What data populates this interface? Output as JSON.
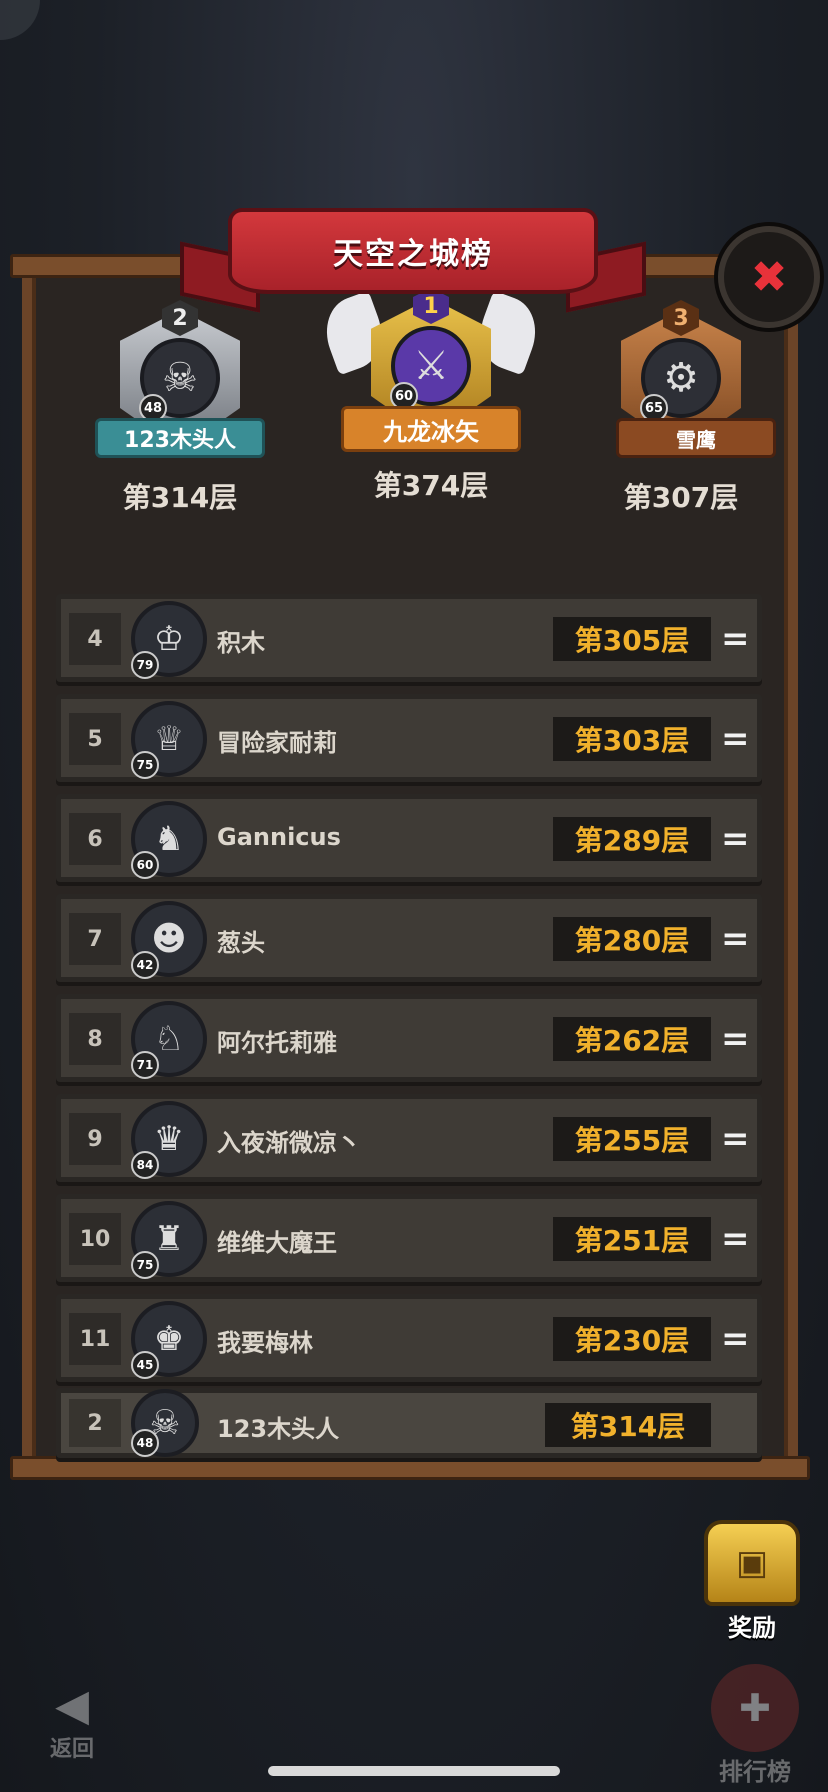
{
  "title": "天空之城榜",
  "close_icon": "✖",
  "podium": [
    {
      "rank": "1",
      "name": "九龙冰矢",
      "level": "60",
      "floor": "第374层",
      "avatar": "⚔"
    },
    {
      "rank": "2",
      "name": "123木头人",
      "level": "48",
      "floor": "第314层",
      "avatar": "☠"
    },
    {
      "rank": "3",
      "name": "雪鹰",
      "level": "65",
      "floor": "第307层",
      "avatar": "⚙"
    }
  ],
  "rows": [
    {
      "rank": "4",
      "name": "积木",
      "level": "79",
      "floor": "第305层",
      "trend": "=",
      "avatar": "♔"
    },
    {
      "rank": "5",
      "name": "冒险家耐莉",
      "level": "75",
      "floor": "第303层",
      "trend": "=",
      "avatar": "♕"
    },
    {
      "rank": "6",
      "name": "Gannicus",
      "level": "60",
      "floor": "第289层",
      "trend": "=",
      "avatar": "♞"
    },
    {
      "rank": "7",
      "name": "葱头",
      "level": "42",
      "floor": "第280层",
      "trend": "=",
      "avatar": "☻"
    },
    {
      "rank": "8",
      "name": "阿尔托莉雅",
      "level": "71",
      "floor": "第262层",
      "trend": "=",
      "avatar": "♘"
    },
    {
      "rank": "9",
      "name": "入夜渐微凉丶",
      "level": "84",
      "floor": "第255层",
      "trend": "=",
      "avatar": "♛"
    },
    {
      "rank": "10",
      "name": "维维大魔王",
      "level": "75",
      "floor": "第251层",
      "trend": "=",
      "avatar": "♜"
    },
    {
      "rank": "11",
      "name": "我要梅林",
      "level": "45",
      "floor": "第230层",
      "trend": "=",
      "avatar": "♚"
    }
  ],
  "self_row": {
    "rank": "2",
    "name": "123木头人",
    "level": "48",
    "floor": "第314层",
    "avatar": "☠"
  },
  "reward_label": "奖励",
  "reward_icon": "▣",
  "back_label": "返回",
  "back_icon": "◀",
  "ranking_label": "排行榜",
  "ranking_icon": "✚"
}
